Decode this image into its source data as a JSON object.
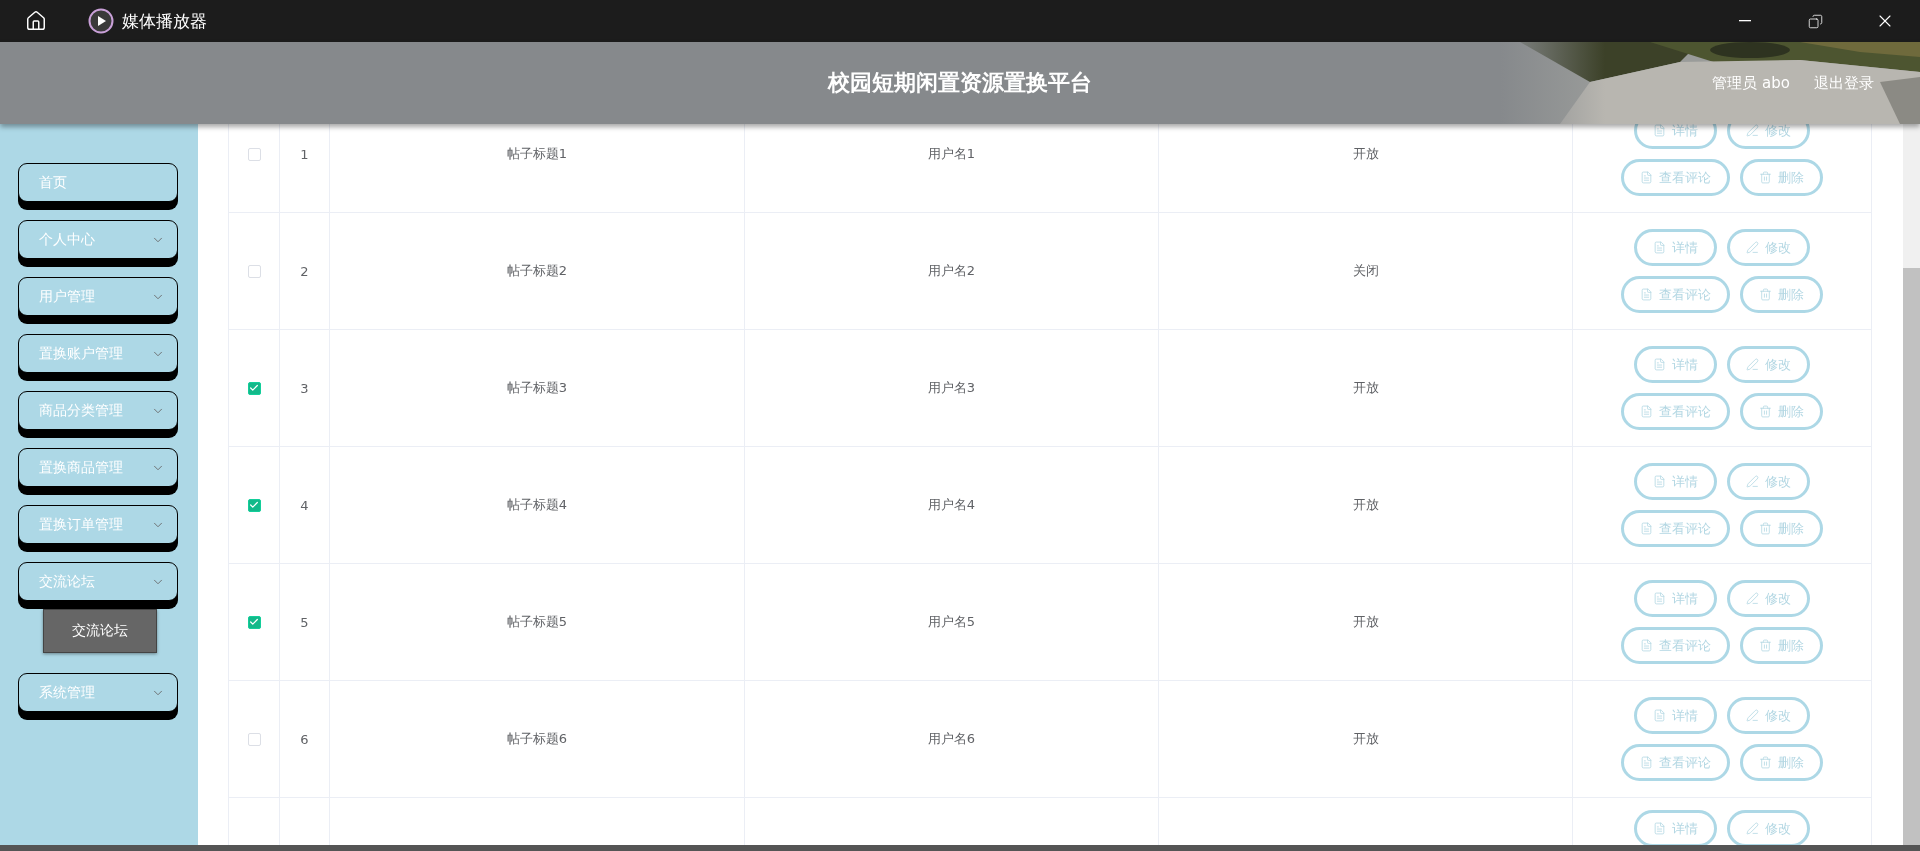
{
  "title_bar": {
    "app_name": "媒体播放器"
  },
  "header": {
    "title": "校园短期闲置资源置换平台",
    "user": "管理员 abo",
    "logout": "退出登录"
  },
  "sidebar": {
    "items": [
      {
        "label": "首页",
        "has_submenu": false
      },
      {
        "label": "个人中心",
        "has_submenu": true
      },
      {
        "label": "用户管理",
        "has_submenu": true
      },
      {
        "label": "置换账户管理",
        "has_submenu": true
      },
      {
        "label": "商品分类管理",
        "has_submenu": true
      },
      {
        "label": "置换商品管理",
        "has_submenu": true
      },
      {
        "label": "置换订单管理",
        "has_submenu": true
      },
      {
        "label": "交流论坛",
        "has_submenu": true,
        "children": [
          {
            "label": "交流论坛"
          }
        ]
      },
      {
        "label": "系统管理",
        "has_submenu": true
      }
    ]
  },
  "table": {
    "rows": [
      {
        "checked": false,
        "index": "1",
        "title": "帖子标题1",
        "user": "用户名1",
        "status": "开放",
        "actions": [
          {
            "kind": "detail",
            "label": "详情"
          },
          {
            "kind": "edit",
            "label": "修改"
          },
          {
            "kind": "comments",
            "label": "查看评论"
          },
          {
            "kind": "delete",
            "label": "删除"
          }
        ]
      },
      {
        "checked": false,
        "index": "2",
        "title": "帖子标题2",
        "user": "用户名2",
        "status": "关闭",
        "actions": [
          {
            "kind": "detail",
            "label": "详情"
          },
          {
            "kind": "edit",
            "label": "修改"
          },
          {
            "kind": "comments",
            "label": "查看评论"
          },
          {
            "kind": "delete",
            "label": "删除"
          }
        ]
      },
      {
        "checked": true,
        "index": "3",
        "title": "帖子标题3",
        "user": "用户名3",
        "status": "开放",
        "actions": [
          {
            "kind": "detail",
            "label": "详情"
          },
          {
            "kind": "edit",
            "label": "修改"
          },
          {
            "kind": "comments",
            "label": "查看评论"
          },
          {
            "kind": "delete",
            "label": "删除"
          }
        ]
      },
      {
        "checked": true,
        "index": "4",
        "title": "帖子标题4",
        "user": "用户名4",
        "status": "开放",
        "actions": [
          {
            "kind": "detail",
            "label": "详情"
          },
          {
            "kind": "edit",
            "label": "修改"
          },
          {
            "kind": "comments",
            "label": "查看评论"
          },
          {
            "kind": "delete",
            "label": "删除"
          }
        ]
      },
      {
        "checked": true,
        "index": "5",
        "title": "帖子标题5",
        "user": "用户名5",
        "status": "开放",
        "actions": [
          {
            "kind": "detail",
            "label": "详情"
          },
          {
            "kind": "edit",
            "label": "修改"
          },
          {
            "kind": "comments",
            "label": "查看评论"
          },
          {
            "kind": "delete",
            "label": "删除"
          }
        ]
      },
      {
        "checked": false,
        "index": "6",
        "title": "帖子标题6",
        "user": "用户名6",
        "status": "开放",
        "actions": [
          {
            "kind": "detail",
            "label": "详情"
          },
          {
            "kind": "edit",
            "label": "修改"
          },
          {
            "kind": "comments",
            "label": "查看评论"
          },
          {
            "kind": "delete",
            "label": "删除"
          }
        ]
      },
      {
        "actions": [
          {
            "kind": "detail",
            "label": "详情"
          },
          {
            "kind": "edit",
            "label": "修改"
          }
        ]
      }
    ]
  }
}
